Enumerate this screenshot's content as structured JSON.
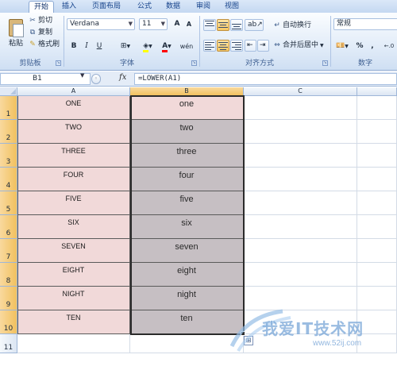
{
  "tabs": {
    "home": "开始",
    "insert": "插入",
    "page_layout": "页面布局",
    "formulas": "公式",
    "data": "数据",
    "review": "审阅",
    "view": "视图"
  },
  "ribbon": {
    "clipboard": {
      "label": "剪贴板",
      "paste": "粘贴",
      "cut": "剪切",
      "copy": "复制",
      "format_painter": "格式刷",
      "icons": [
        "scissors-icon",
        "copy-icon",
        "brush-icon"
      ]
    },
    "font": {
      "label": "字体",
      "font_name": "Verdana",
      "font_size": "11",
      "grow": "A",
      "shrink": "A",
      "bold": "B",
      "italic": "I",
      "underline": "U",
      "phonetic": "wén",
      "font_color": "#ff0000",
      "fill_color": "#ffff00"
    },
    "alignment": {
      "label": "对齐方式",
      "wrap_text": "自动换行",
      "merge_center": "合并后居中"
    },
    "number": {
      "label": "数字",
      "format": "常规",
      "percent": "%",
      "comma": ","
    }
  },
  "formula_bar": {
    "cell_ref": "B1",
    "fx": "fx",
    "formula": "=LOWER(A1)"
  },
  "columns": [
    "A",
    "B",
    "C"
  ],
  "rows": [
    {
      "num": "1",
      "a": "ONE",
      "b": "one"
    },
    {
      "num": "2",
      "a": "TWO",
      "b": "two"
    },
    {
      "num": "3",
      "a": "THREE",
      "b": "three"
    },
    {
      "num": "4",
      "a": "FOUR",
      "b": "four"
    },
    {
      "num": "5",
      "a": "FIVE",
      "b": "five"
    },
    {
      "num": "6",
      "a": "SIX",
      "b": "six"
    },
    {
      "num": "7",
      "a": "SEVEN",
      "b": "seven"
    },
    {
      "num": "8",
      "a": "EIGHT",
      "b": "eight"
    },
    {
      "num": "9",
      "a": "NIGHT",
      "b": "night"
    },
    {
      "num": "10",
      "a": "TEN",
      "b": "ten"
    },
    {
      "num": "11",
      "a": "",
      "b": ""
    }
  ],
  "watermark": {
    "text": "我爱IT技术网",
    "url": "www.52ij.com"
  }
}
